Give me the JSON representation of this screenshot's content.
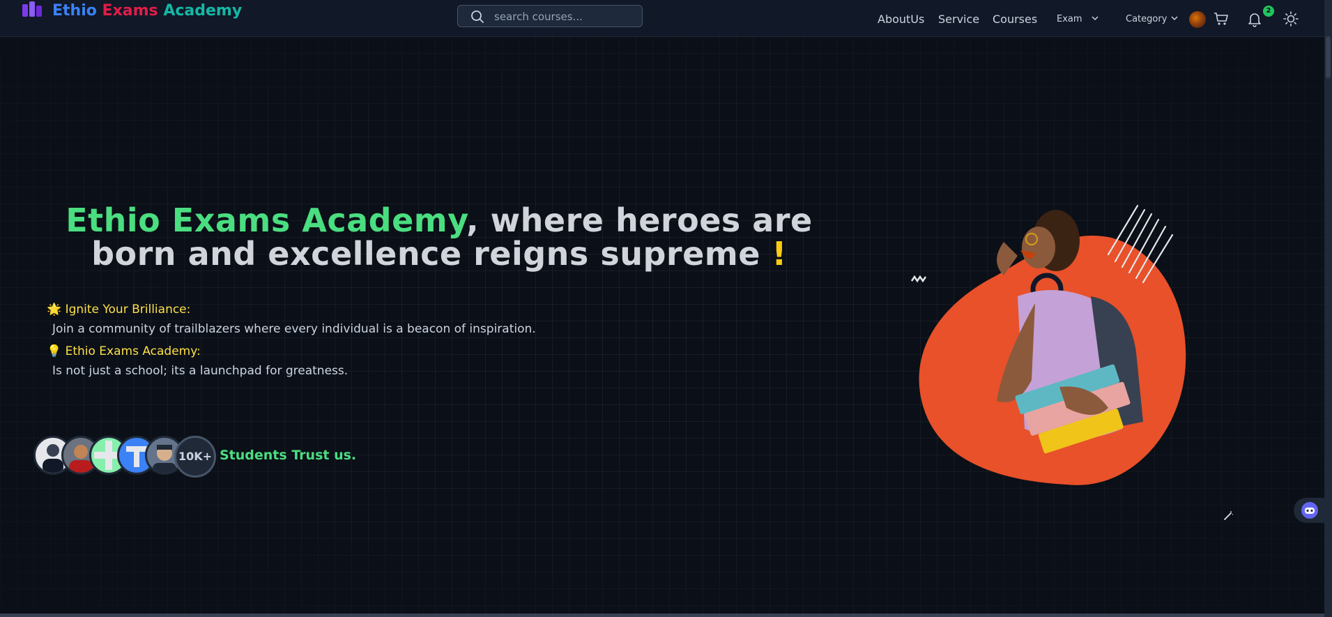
{
  "brand": {
    "part1": "Ethio",
    "part2": "Exams",
    "part3": "Academy"
  },
  "search": {
    "placeholder": "search courses..."
  },
  "nav": {
    "about": "AboutUs",
    "service": "Service",
    "courses": "Courses",
    "exam": "Exam",
    "category": "Category",
    "notification_count": "2",
    "icons": [
      "user-avatar",
      "cart-icon",
      "bell-icon",
      "sun-icon"
    ]
  },
  "hero": {
    "headline_highlight": "Ethio Exams Academy",
    "headline_rest": ", where heroes are born and excellence reigns supreme",
    "headline_bang": "!",
    "features": [
      {
        "icon": "🌟",
        "title": "Ignite Your Brilliance:",
        "desc": "Join a community of trailblazers where every individual is a beacon of inspiration."
      },
      {
        "icon": "💡",
        "title": "Ethio Exams Academy:",
        "desc": "Is not just a school; its a launchpad for greatness."
      }
    ],
    "students_count": "10K+",
    "trust_text": "Students Trust us."
  },
  "colors": {
    "brand_blue": "#3b82f6",
    "brand_red": "#e11d48",
    "brand_teal": "#14b8a6",
    "accent_green": "#4ade80",
    "accent_yellow": "#facc15",
    "blob_orange": "#e8512a"
  }
}
